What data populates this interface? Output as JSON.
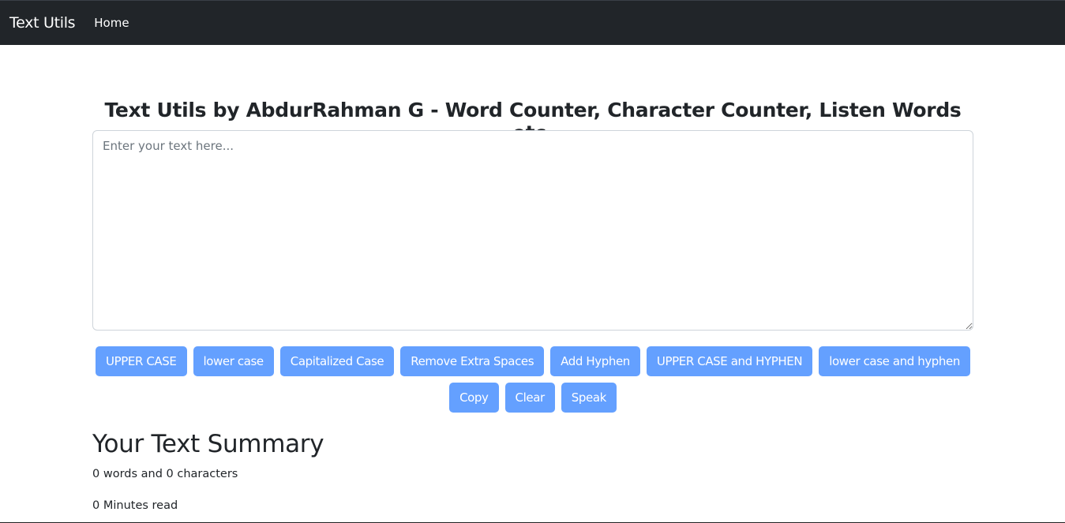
{
  "navbar": {
    "brand": "Text Utils",
    "links": [
      {
        "label": "Home"
      }
    ]
  },
  "main": {
    "heading": "Text Utils by AbdurRahman G - Word Counter, Character Counter, Listen Words etc.",
    "textarea": {
      "value": "",
      "placeholder": "Enter your text here..."
    },
    "buttons_row1": [
      {
        "label": "UPPER CASE"
      },
      {
        "label": "lower case"
      },
      {
        "label": "Capitalized Case"
      },
      {
        "label": "Remove Extra Spaces"
      },
      {
        "label": "Add Hyphen"
      },
      {
        "label": "UPPER CASE and HYPHEN"
      },
      {
        "label": "lower case and hyphen"
      }
    ],
    "buttons_row2": [
      {
        "label": "Copy"
      },
      {
        "label": "Clear"
      },
      {
        "label": "Speak"
      }
    ]
  },
  "summary": {
    "heading": "Your Text Summary",
    "counts": "0 words and 0 characters",
    "read_time": "0 Minutes read"
  },
  "colors": {
    "navbar_bg": "#212529",
    "button_bg": "#64a0ff"
  }
}
